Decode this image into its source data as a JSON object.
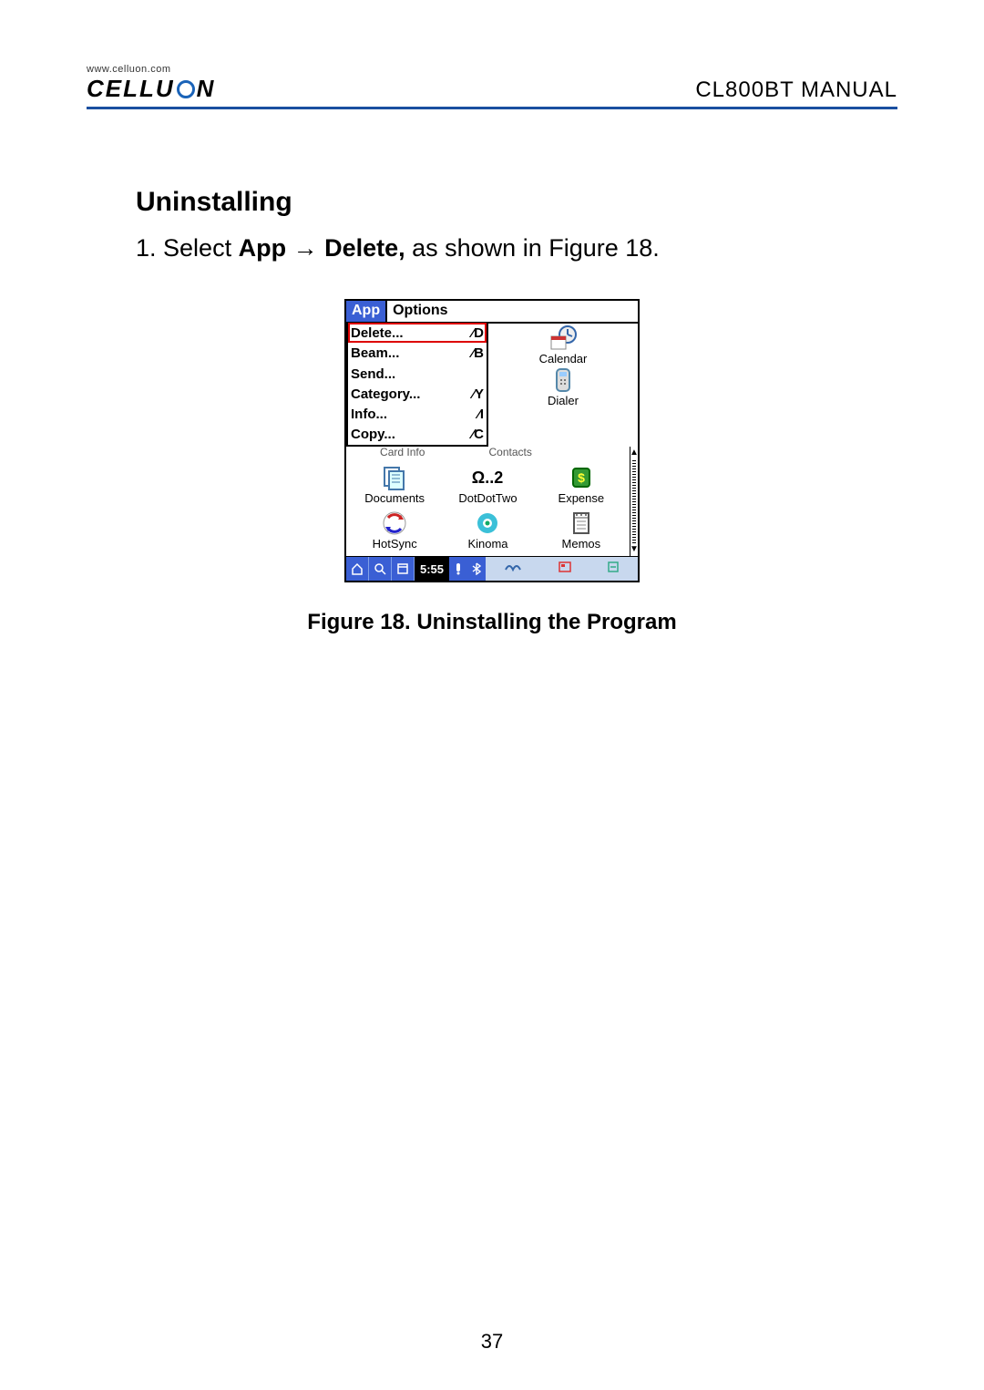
{
  "header": {
    "brand_url": "www.celluon.com",
    "brand_text_part1": "CELLU",
    "brand_text_part2": "N",
    "manual_label": "CL800BT MANUAL"
  },
  "section_title": "Uninstalling",
  "step": {
    "num": "1. ",
    "pre": "Select ",
    "bold1": "App ",
    "arrow": "→",
    "bold2": " Delete,",
    "post": " as shown in Figure 18."
  },
  "palm": {
    "menubar": {
      "app": "App",
      "options": "Options"
    },
    "menu_items": [
      {
        "label": "Delete...",
        "shortcut": "⁄D",
        "selected": true
      },
      {
        "label": "Beam...",
        "shortcut": "⁄B",
        "selected": false
      },
      {
        "label": "Send...",
        "shortcut": "",
        "selected": false
      },
      {
        "label": "Category...",
        "shortcut": "⁄Y",
        "selected": false
      },
      {
        "label": "Info...",
        "shortcut": "⁄I",
        "selected": false
      },
      {
        "label": "Copy...",
        "shortcut": "⁄C",
        "selected": false
      }
    ],
    "right_apps": [
      {
        "name": "Calendar"
      },
      {
        "name": "Dialer"
      }
    ],
    "cut_labels": [
      "Card Info",
      "Contacts"
    ],
    "grid_apps": [
      {
        "name": "Documents"
      },
      {
        "name": "DotDotTwo"
      },
      {
        "name": "Expense"
      },
      {
        "name": "HotSync"
      },
      {
        "name": "Kinoma"
      },
      {
        "name": "Memos"
      }
    ],
    "clock": "5:55"
  },
  "figure_caption": "Figure 18. Uninstalling the Program",
  "page_number": "37"
}
